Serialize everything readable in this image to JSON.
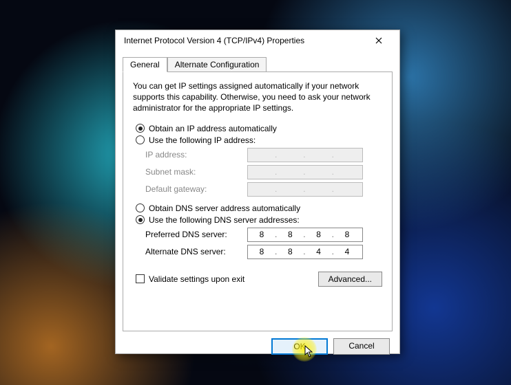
{
  "window": {
    "title": "Internet Protocol Version 4 (TCP/IPv4) Properties"
  },
  "tabs": {
    "general": "General",
    "alt": "Alternate Configuration"
  },
  "intro": "You can get IP settings assigned automatically if your network supports this capability. Otherwise, you need to ask your network administrator for the appropriate IP settings.",
  "ip_section": {
    "auto": "Obtain an IP address automatically",
    "manual": "Use the following IP address:",
    "ip_label": "IP address:",
    "subnet_label": "Subnet mask:",
    "gateway_label": "Default gateway:"
  },
  "dns_section": {
    "auto": "Obtain DNS server address automatically",
    "manual": "Use the following DNS server addresses:",
    "preferred_label": "Preferred DNS server:",
    "alternate_label": "Alternate DNS server:",
    "preferred_value": [
      "8",
      "8",
      "8",
      "8"
    ],
    "alternate_value": [
      "8",
      "8",
      "4",
      "4"
    ]
  },
  "validate_label": "Validate settings upon exit",
  "advanced_label": "Advanced...",
  "buttons": {
    "ok": "OK",
    "cancel": "Cancel"
  }
}
